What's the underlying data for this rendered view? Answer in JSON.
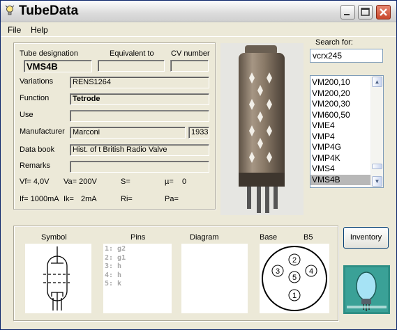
{
  "window": {
    "title": "TubeData"
  },
  "menu": {
    "file": "File",
    "help": "Help"
  },
  "labels": {
    "tube_designation": "Tube designation",
    "equivalent_to": "Equivalent to",
    "cv_number": "CV number",
    "variations": "Variations",
    "function": "Function",
    "use": "Use",
    "manufacturer": "Manufacturer",
    "data_book": "Data book",
    "remarks": "Remarks"
  },
  "tube": {
    "designation": "VMS4B",
    "equivalent": "",
    "cv_number": "",
    "variations": "RENS1264",
    "function": "Tetrode",
    "use": "",
    "manufacturer": "Marconi",
    "year": "1933",
    "data_book": "Hist. of t British Radio Valve",
    "remarks": ""
  },
  "params": {
    "vf": "Vf= 4,0V",
    "va": "Va= 200V",
    "s": "S=",
    "mu": "µ=",
    "mu_val": "0",
    "if": "If= 1000mA",
    "ik": "Ik=",
    "ik_val": "2mA",
    "ri": "Ri=",
    "pa": "Pa="
  },
  "search": {
    "label": "Search for:",
    "value": "vcrx245",
    "results": [
      "VM200,10",
      "VM200,20",
      "VM200,30",
      "VM600,50",
      "VME4",
      "VMP4",
      "VMP4G",
      "VMP4K",
      "VMS4",
      "VMS4B"
    ],
    "selected": "VMS4B"
  },
  "bottom": {
    "symbol": "Symbol",
    "pins": "Pins",
    "diagram": "Diagram",
    "base": "Base",
    "base_type": "B5",
    "pin_list": [
      "1: g2",
      "2: g1",
      "3: h",
      "4: h",
      "5: k"
    ],
    "base_pin_numbers": [
      "1",
      "2",
      "3",
      "4",
      "5"
    ]
  },
  "inventory_button": "Inventory",
  "colors": {
    "titlebar": "#dcdcdc",
    "close_button": "#c8462b",
    "selection": "#b8b8b8",
    "listbox_border": "#7f9db9"
  }
}
